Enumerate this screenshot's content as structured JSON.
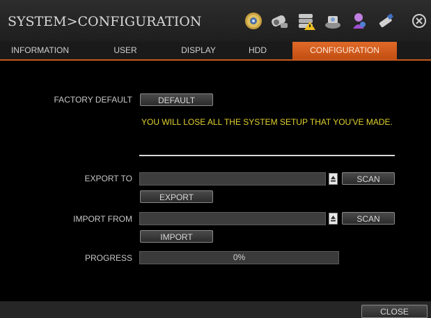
{
  "header": {
    "title": "SYSTEM>CONFIGURATION",
    "toolbar_icons": [
      "gear-icon",
      "camera-icon",
      "storage-warning-icon",
      "network-icon",
      "user-icon",
      "usb-icon",
      "close-icon"
    ]
  },
  "tabs": [
    {
      "label": "INFORMATION"
    },
    {
      "label": "USER"
    },
    {
      "label": "DISPLAY"
    },
    {
      "label": "HDD"
    },
    {
      "label": "CONFIGURATION",
      "active": true
    }
  ],
  "factory_default": {
    "label": "FACTORY DEFAULT",
    "button_label": "DEFAULT",
    "warning": "YOU WILL LOSE ALL THE SYSTEM SETUP THAT YOU'VE MADE."
  },
  "export": {
    "label": "EXPORT TO",
    "path_value": "",
    "scan_label": "SCAN",
    "button_label": "EXPORT"
  },
  "import": {
    "label": "IMPORT FROM",
    "path_value": "",
    "scan_label": "SCAN",
    "button_label": "IMPORT"
  },
  "progress": {
    "label": "PROGRESS",
    "value_text": "0%",
    "fraction": 0
  },
  "footer": {
    "close_label": "CLOSE"
  },
  "colors": {
    "accent": "#d25a1a",
    "warning_text": "#e0d030"
  }
}
